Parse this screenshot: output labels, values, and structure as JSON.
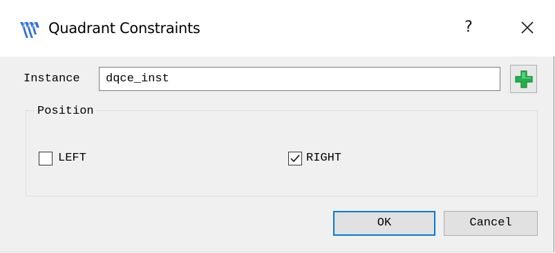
{
  "window": {
    "title": "Quadrant Constraints",
    "help_label": "?",
    "app_icon": "gowin-logo-icon",
    "close_icon": "close-icon"
  },
  "instance": {
    "label": "Instance",
    "value": "dqce_inst",
    "add_icon": "plus-icon",
    "add_color": "#22b14c"
  },
  "position": {
    "title": "Position",
    "options": [
      {
        "label": "LEFT",
        "checked": false
      },
      {
        "label": "RIGHT",
        "checked": true
      }
    ]
  },
  "buttons": {
    "ok": "OK",
    "cancel": "Cancel"
  },
  "colors": {
    "accent": "#0078d7",
    "dialog_bg": "#f0f0f0",
    "logo": "#2f6fd6"
  }
}
